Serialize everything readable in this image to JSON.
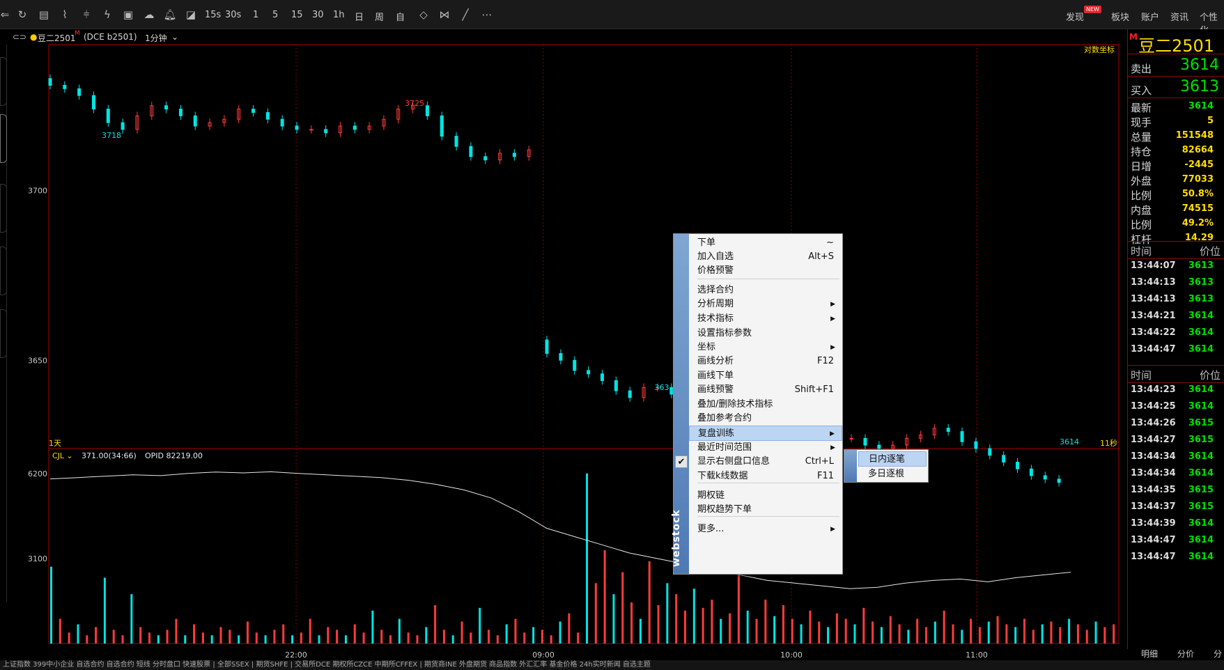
{
  "toolbar": {
    "icons": [
      "back-icon",
      "refresh-icon",
      "list-icon",
      "line-chart-icon",
      "candlestick-icon",
      "lightning-icon",
      "book-icon",
      "cloud-icon",
      "bell-icon",
      "chart-icon"
    ],
    "periods": [
      "15s",
      "30s",
      "1",
      "5",
      "15",
      "30",
      "1h",
      "日",
      "周",
      "自"
    ],
    "tools": [
      "split-icon",
      "compare-icon",
      "pen-icon",
      "more-icon"
    ],
    "right_menu": [
      "发现",
      "板块",
      "账户",
      "资讯",
      "个性化"
    ],
    "new_badge": "NEW"
  },
  "contract": {
    "name": "豆二2501",
    "code": "(DCE b2501)",
    "period": "1分钟",
    "flag": "M"
  },
  "chart_data": [
    {
      "type": "candlestick",
      "title": "",
      "ylabel": "",
      "x_ticks": [
        "22:00",
        "09:00",
        "10:00",
        "11:00"
      ],
      "y_ticks": [
        3700,
        3650
      ],
      "ylim": [
        3624,
        3743
      ],
      "log_axis_label": "对数坐标",
      "range_label": "1天",
      "countdown_label": "11秒",
      "annotations": [
        {
          "text": "3718",
          "value": 3718
        },
        {
          "text": "3725",
          "value": 3725
        },
        {
          "text": "363",
          "value": 3637
        },
        {
          "text": "3614",
          "value": 3614
        }
      ],
      "close_series": [
        3731,
        3730,
        3728,
        3724,
        3720,
        3718,
        3722,
        3725,
        3724,
        3722,
        3719,
        3720,
        3721,
        3724,
        3723,
        3721,
        3719,
        3718,
        3718,
        3717,
        3719,
        3718,
        3719,
        3721,
        3724,
        3725,
        3722,
        3716,
        3713,
        3710,
        3709,
        3711,
        3710,
        3712,
        3652,
        3650,
        3647,
        3646,
        3644,
        3641,
        3639,
        3642,
        3642,
        3640,
        3636,
        3633,
        3631,
        3637,
        3637,
        3636,
        3634,
        3632,
        3631,
        3630,
        3629,
        3627,
        3627,
        3625,
        3624,
        3625,
        3627,
        3628,
        3630,
        3629,
        3626,
        3624,
        3622,
        3620,
        3618,
        3616,
        3615,
        3614
      ]
    },
    {
      "type": "bar",
      "indicator_label": "CJL",
      "indicator_values": "371.00(34:66)",
      "opid_label": "OPID 82219.00",
      "y_ticks": [
        6200,
        3100
      ],
      "ylim": [
        0,
        6600
      ],
      "volume_values": [
        2800,
        900,
        400,
        700,
        300,
        600,
        2400,
        500,
        300,
        1800,
        600,
        400,
        300,
        500,
        900,
        300,
        700,
        400,
        300,
        600,
        500,
        300,
        800,
        400,
        300,
        500,
        700,
        300,
        400,
        900,
        300,
        600,
        500,
        300,
        700,
        400,
        1200,
        500,
        300,
        900,
        400,
        300,
        600,
        1400,
        500,
        300,
        800,
        400,
        1300,
        500,
        300,
        700,
        900,
        400,
        600,
        500,
        300,
        800,
        1100,
        400,
        6200,
        2200,
        3400,
        1800,
        2600,
        1500,
        900,
        3000,
        1400,
        2200,
        1800,
        1200,
        2000,
        1300,
        1600,
        900,
        1100,
        2500,
        1200,
        900,
        1600,
        1000,
        1400,
        900,
        700,
        1200,
        800,
        600,
        1100,
        900,
        700,
        1300,
        800,
        600,
        1000,
        700,
        500,
        900,
        600,
        800,
        1200,
        700,
        500,
        900,
        600,
        800,
        1000,
        700,
        600,
        900,
        500,
        700,
        800,
        600,
        900,
        700,
        500,
        800,
        600,
        700
      ],
      "opid_series": [
        6000,
        6050,
        6100,
        6150,
        6120,
        6200,
        6250,
        6220,
        6260,
        6200,
        6150,
        6100,
        6050,
        5950,
        5800,
        5600,
        5300,
        4800,
        4200,
        3900,
        3600,
        3300,
        3100,
        2900,
        2700,
        2500,
        2300,
        2200,
        2100,
        2000,
        2050,
        2200,
        2300,
        2350,
        2250,
        2400,
        2500,
        2600
      ]
    }
  ],
  "quote": {
    "title": "豆二2501",
    "ask_label": "卖出",
    "ask": "3614",
    "bid_label": "买入",
    "bid": "3613",
    "rows": [
      {
        "label": "最新",
        "value": "3614",
        "color": "#00e000"
      },
      {
        "label": "现手",
        "value": "5",
        "color": "#ffde00"
      },
      {
        "label": "总量",
        "value": "151548",
        "color": "#ffde00"
      },
      {
        "label": "持仓",
        "value": "82664",
        "color": "#ffde00"
      },
      {
        "label": "日增",
        "value": "-2445",
        "color": "#ffde00"
      },
      {
        "label": "外盘",
        "value": "77033",
        "color": "#ffde00"
      },
      {
        "label": "比例",
        "value": "50.8%",
        "color": "#ffde00"
      },
      {
        "label": "内盘",
        "value": "74515",
        "color": "#ffde00"
      },
      {
        "label": "比例",
        "value": "49.2%",
        "color": "#ffde00"
      },
      {
        "label": "杠杆",
        "value": "14.29",
        "color": "#ffde00"
      }
    ]
  },
  "trades1": {
    "head_time": "时间",
    "head_price": "价位",
    "rows": [
      {
        "time": "13:44:07",
        "price": "3613"
      },
      {
        "time": "13:44:13",
        "price": "3613"
      },
      {
        "time": "13:44:13",
        "price": "3613"
      },
      {
        "time": "13:44:21",
        "price": "3614"
      },
      {
        "time": "13:44:22",
        "price": "3614"
      },
      {
        "time": "13:44:47",
        "price": "3614"
      }
    ]
  },
  "trades2": {
    "head_time": "时间",
    "head_price": "价位",
    "rows": [
      {
        "time": "13:44:23",
        "price": "3614"
      },
      {
        "time": "13:44:25",
        "price": "3614"
      },
      {
        "time": "13:44:26",
        "price": "3615"
      },
      {
        "time": "13:44:27",
        "price": "3615"
      },
      {
        "time": "13:44:34",
        "price": "3614"
      },
      {
        "time": "13:44:34",
        "price": "3614"
      },
      {
        "time": "13:44:35",
        "price": "3615"
      },
      {
        "time": "13:44:37",
        "price": "3615"
      },
      {
        "time": "13:44:39",
        "price": "3614"
      },
      {
        "time": "13:44:47",
        "price": "3614"
      },
      {
        "time": "13:44:47",
        "price": "3614"
      }
    ]
  },
  "panel_tabs": [
    "明细",
    "分价",
    "分"
  ],
  "context_menu": {
    "items": [
      {
        "label": "下单",
        "shortcut": "~"
      },
      {
        "label": "加入自选",
        "shortcut": "Alt+S"
      },
      {
        "label": "价格预警",
        "shortcut": ""
      },
      {
        "label": "选择合约",
        "shortcut": ""
      },
      {
        "label": "分析周期",
        "shortcut": "▶"
      },
      {
        "label": "技术指标",
        "shortcut": "▶"
      },
      {
        "label": "设置指标参数",
        "shortcut": ""
      },
      {
        "label": "坐标",
        "shortcut": "▶"
      },
      {
        "label": "画线分析",
        "shortcut": "F12"
      },
      {
        "label": "画线下单",
        "shortcut": ""
      },
      {
        "label": "画线预警",
        "shortcut": "Shift+F1"
      },
      {
        "label": "叠加/删除技术指标",
        "shortcut": ""
      },
      {
        "label": "叠加参考合约",
        "shortcut": ""
      },
      {
        "label": "复盘训练",
        "shortcut": "▶"
      },
      {
        "label": "最近时间范围",
        "shortcut": "▶"
      },
      {
        "label": "显示右侧盘口信息",
        "shortcut": "Ctrl+L"
      },
      {
        "label": "下载k线数据",
        "shortcut": "F11"
      },
      {
        "label": "期权链",
        "shortcut": ""
      },
      {
        "label": "期权趋势下单",
        "shortcut": ""
      },
      {
        "label": "更多...",
        "shortcut": "▶"
      }
    ],
    "brand": "webstock",
    "submenu": [
      "日内逐笔",
      "多日逐根"
    ]
  },
  "ticker": "上证指数  399中小企业  自选合约  自选合约  短线  分时盘口  快速股票  | 全部SSEX  | 期货SHFE  | 交易所DCE  期权所CZCE  中期所CFFEX  | 期货商INE  外盘期货  商品指数  外汇汇率  基金价格  24h实时新闻  自选主题"
}
